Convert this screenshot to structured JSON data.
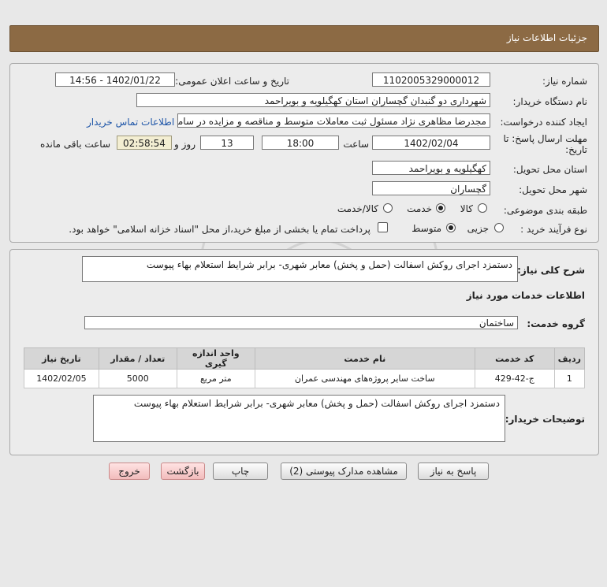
{
  "page_title": "جزئیات اطلاعات نیاز",
  "fields": {
    "need_number_label": "شماره نیاز:",
    "need_number": "1102005329000012",
    "announce_label": "تاریخ و ساعت اعلان عمومی:",
    "announce_value": "1402/01/22 - 14:56",
    "buyer_label": "نام دستگاه خریدار:",
    "buyer_value": "شهرداری دو گنبدان گچساران استان کهگیلویه و بویراحمد",
    "creator_label": "ایجاد کننده درخواست:",
    "creator_value": "مجدرضا مظاهری نژاد مسئول ثبت معاملات متوسط و مناقصه و مزایده در سامانه",
    "contact_link": "اطلاعات تماس خریدار",
    "deadline_label_1": "مهلت ارسال پاسخ: تا",
    "deadline_label_2": "تاریخ:",
    "deadline_date": "1402/02/04",
    "time_label": "ساعت",
    "deadline_time": "18:00",
    "days_value": "13",
    "days_label": "روز و",
    "remain_value": "02:58:54",
    "remain_label": "ساعت باقی مانده",
    "province_label": "استان محل تحویل:",
    "province_value": "کهگیلویه و بویراحمد",
    "city_label": "شهر محل تحویل:",
    "city_value": "گچساران",
    "category_label": "طبقه بندی موضوعی:",
    "cat_goods": "کالا",
    "cat_service": "خدمت",
    "cat_both": "کالا/خدمت",
    "process_label": "نوع فرآیند خرید :",
    "proc_partial": "جزیی",
    "proc_medium": "متوسط",
    "payment_note": "پرداخت تمام یا بخشی از مبلغ خرید،از محل \"اسناد خزانه اسلامی\" خواهد بود."
  },
  "summary": {
    "label": "شرح کلی نیاز:",
    "value": "دستمزد اجرای روکش اسفالت (حمل و پخش) معابر شهری- برابر شرایط استعلام بهاء پیوست"
  },
  "services": {
    "title": "اطلاعات خدمات مورد نیاز",
    "group_label": "گروه خدمت:",
    "group_value": "ساختمان"
  },
  "table": {
    "headers": [
      "ردیف",
      "کد خدمت",
      "نام خدمت",
      "واحد اندازه گیری",
      "تعداد / مقدار",
      "تاریخ نیاز"
    ],
    "rows": [
      [
        "1",
        "ج-42-429",
        "ساخت سایر پروژه‌های مهندسی عمران",
        "متر مربع",
        "5000",
        "1402/02/05"
      ]
    ]
  },
  "buyer_notes": {
    "label": "توضیحات خریدار:",
    "value": "دستمزد اجرای روکش اسفالت (حمل و پخش) معابر شهری- برابر شرایط استعلام بهاء پیوست"
  },
  "buttons": {
    "reply": "پاسخ به نیاز",
    "attachments": "مشاهده مدارک پیوستی (2)",
    "print": "چاپ",
    "back": "بازگشت",
    "exit": "خروج"
  },
  "colors": {
    "header": "#8c6a44",
    "link": "#1f56a8",
    "pink_button": "#f2bcbc"
  }
}
